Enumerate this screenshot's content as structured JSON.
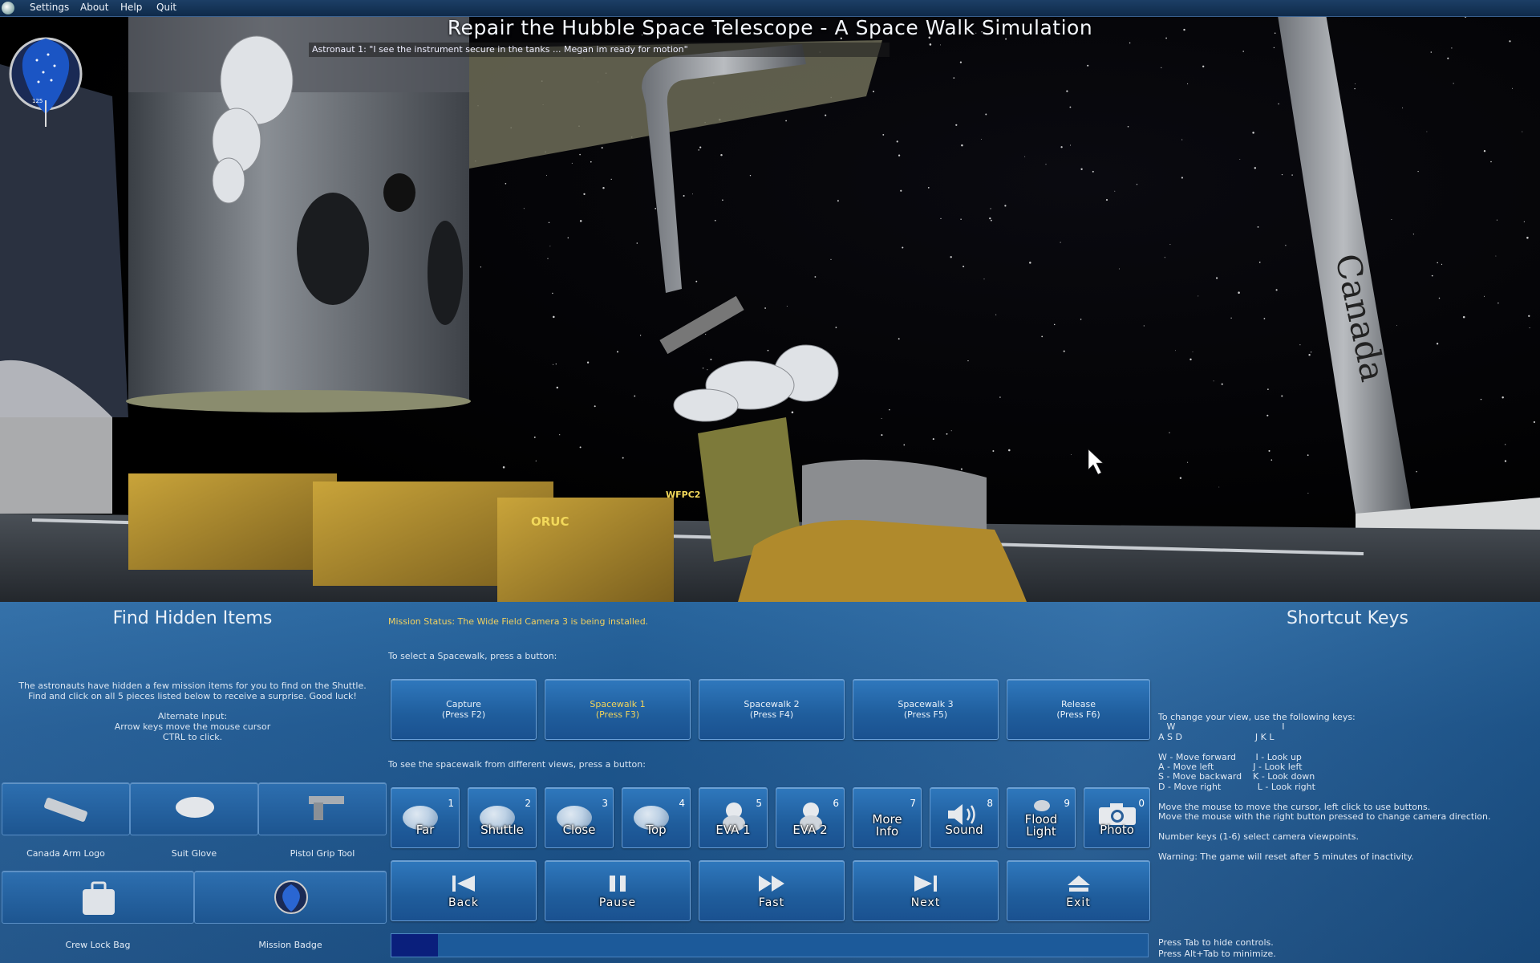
{
  "menubar": {
    "items": [
      "Settings",
      "About",
      "Help",
      "Quit"
    ]
  },
  "title": "Repair the Hubble Space Telescope - A Space Walk Simulation",
  "dialogue": "Astronaut 1: \"I see the instrument secure in the tanks ... Megan im ready for motion\"",
  "scene": {
    "labels": {
      "canada": "Canada",
      "oruc": "ORUC",
      "wfpc2": "WFPC2"
    },
    "patch_number": "125"
  },
  "hidden_items": {
    "heading": "Find Hidden Items",
    "description": "The astronauts have hidden a few mission items for you to find on the Shuttle.\nFind and click on all 5 pieces listed below to receive a surprise. Good luck!",
    "alternate": "Alternate input:\nArrow keys move the mouse cursor\nCTRL to click.",
    "items": [
      {
        "label": "Canada Arm Logo",
        "icon": "canada-arm-logo-icon"
      },
      {
        "label": "Suit Glove",
        "icon": "suit-glove-icon"
      },
      {
        "label": "Pistol Grip Tool",
        "icon": "pistol-grip-tool-icon"
      },
      {
        "label": "Crew Lock Bag",
        "icon": "crew-lock-bag-icon"
      },
      {
        "label": "Mission Badge",
        "icon": "mission-badge-icon"
      }
    ]
  },
  "mission_status": "Mission Status: The Wide Field Camera 3 is being installed.",
  "spacewalk": {
    "prompt": "To select a Spacewalk, press a button:",
    "active_index": 1,
    "buttons": [
      {
        "line1": "Capture",
        "line2": "(Press F2)"
      },
      {
        "line1": "Spacewalk 1",
        "line2": "(Press F3)"
      },
      {
        "line1": "Spacewalk 2",
        "line2": "(Press F4)"
      },
      {
        "line1": "Spacewalk 3",
        "line2": "(Press F5)"
      },
      {
        "line1": "Release",
        "line2": "(Press F6)"
      }
    ]
  },
  "views": {
    "prompt": "To see the spacewalk from different views, press a button:",
    "buttons": [
      {
        "num": "1",
        "label": "Far",
        "icon": "far-view-icon"
      },
      {
        "num": "2",
        "label": "Shuttle",
        "icon": "shuttle-view-icon"
      },
      {
        "num": "3",
        "label": "Close",
        "icon": "close-view-icon"
      },
      {
        "num": "4",
        "label": "Top",
        "icon": "top-view-icon"
      },
      {
        "num": "5",
        "label": "EVA 1",
        "icon": "astronaut-1-icon"
      },
      {
        "num": "6",
        "label": "EVA 2",
        "icon": "astronaut-2-icon"
      },
      {
        "num": "7",
        "label": "More\nInfo",
        "icon": "more-info-icon"
      },
      {
        "num": "8",
        "label": "Sound",
        "icon": "speaker-icon"
      },
      {
        "num": "9",
        "label": "Flood\nLight",
        "icon": "flood-light-icon"
      },
      {
        "num": "0",
        "label": "Photo",
        "icon": "camera-icon"
      }
    ]
  },
  "transport": [
    {
      "label": "Back",
      "icon": "back-icon"
    },
    {
      "label": "Pause",
      "icon": "pause-icon"
    },
    {
      "label": "Fast",
      "icon": "fast-forward-icon"
    },
    {
      "label": "Next",
      "icon": "next-icon"
    },
    {
      "label": "Exit",
      "icon": "exit-icon"
    }
  ],
  "progress": {
    "fraction": 0.062
  },
  "shortcuts": {
    "heading": "Shortcut Keys",
    "text": "To change your view, use the following keys:\n   W                                      I\nA S D                          J K L\n\nW - Move forward       I - Look up\nA - Move left              J - Look left\nS - Move backward    K - Look down\nD - Move right             L - Look right\n\nMove the mouse to move the cursor, left click to use buttons.\nMove the mouse with the right button pressed to change camera direction.\n\nNumber keys (1-6) select camera viewpoints.\n\nWarning: The game will reset after 5 minutes of inactivity.",
    "tab_hint": "Press Tab to hide controls.\nPress Alt+Tab to minimize."
  },
  "colors": {
    "panel": "#1f5a94",
    "button": "#2f78bd",
    "status": "#f0d060",
    "progress_fill": "#0a1f7c"
  }
}
